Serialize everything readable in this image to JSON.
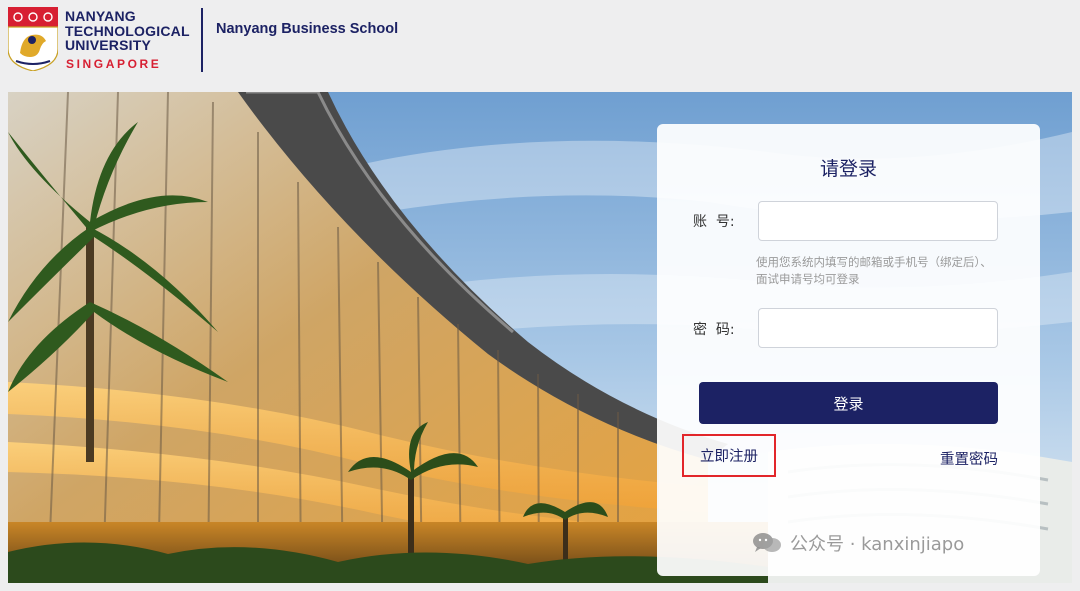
{
  "header": {
    "university_lines": [
      "NANYANG",
      "TECHNOLOGICAL",
      "UNIVERSITY"
    ],
    "university_country": "SINGAPORE",
    "school_name": "Nanyang Business School"
  },
  "login": {
    "title": "请登录",
    "account_label": "账  号:",
    "account_value": "",
    "account_hint": "使用您系统内填写的邮箱或手机号（绑定后）、面试申请号均可登录",
    "password_label": "密  码:",
    "password_value": "",
    "submit_label": "登录",
    "register_label": "立即注册",
    "reset_label": "重置密码"
  },
  "watermark": {
    "icon": "wechat-icon",
    "text": "公众号 · kanxinjiapo"
  },
  "colors": {
    "brand_navy": "#1c2264",
    "brand_red": "#d71f32",
    "highlight_red": "#e2262a"
  }
}
